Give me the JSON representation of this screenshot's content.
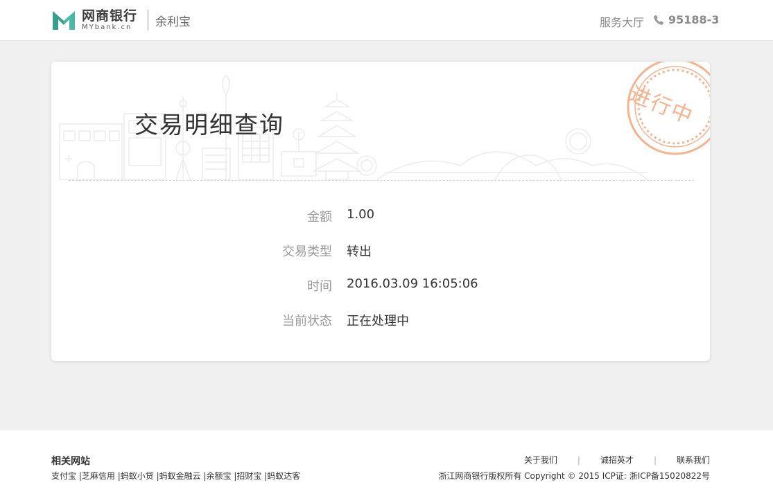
{
  "header": {
    "logo_cn": "网商银行",
    "logo_en": "MYbank.cn",
    "product": "余利宝",
    "service_hall": "服务大厅",
    "phone_icon": "phone-icon",
    "phone": "95188-3"
  },
  "card": {
    "title": "交易明细查询",
    "stamp": "进行中",
    "stamp_color": "#f3b38f",
    "details": [
      {
        "label": "金额",
        "value": "1.00"
      },
      {
        "label": "交易类型",
        "value": "转出"
      },
      {
        "label": "时间",
        "value": "2016.03.09 16:05:06"
      },
      {
        "label": "当前状态",
        "value": "正在处理中"
      }
    ]
  },
  "footer": {
    "title": "相关网站",
    "links": [
      "支付宝",
      "芝麻信用",
      "蚂蚁小贷",
      "蚂蚁金融云",
      "余额宝",
      "招财宝",
      "蚂蚁达客"
    ],
    "nav": [
      "关于我们",
      "诚招英才",
      "联系我们"
    ],
    "copyright": "浙江网商银行版权所有 Copyright © 2015 ICP证: 浙ICP备15020822号"
  },
  "colors": {
    "logo_green": "#4cb8a6",
    "page_bg": "#f0f0f0"
  }
}
